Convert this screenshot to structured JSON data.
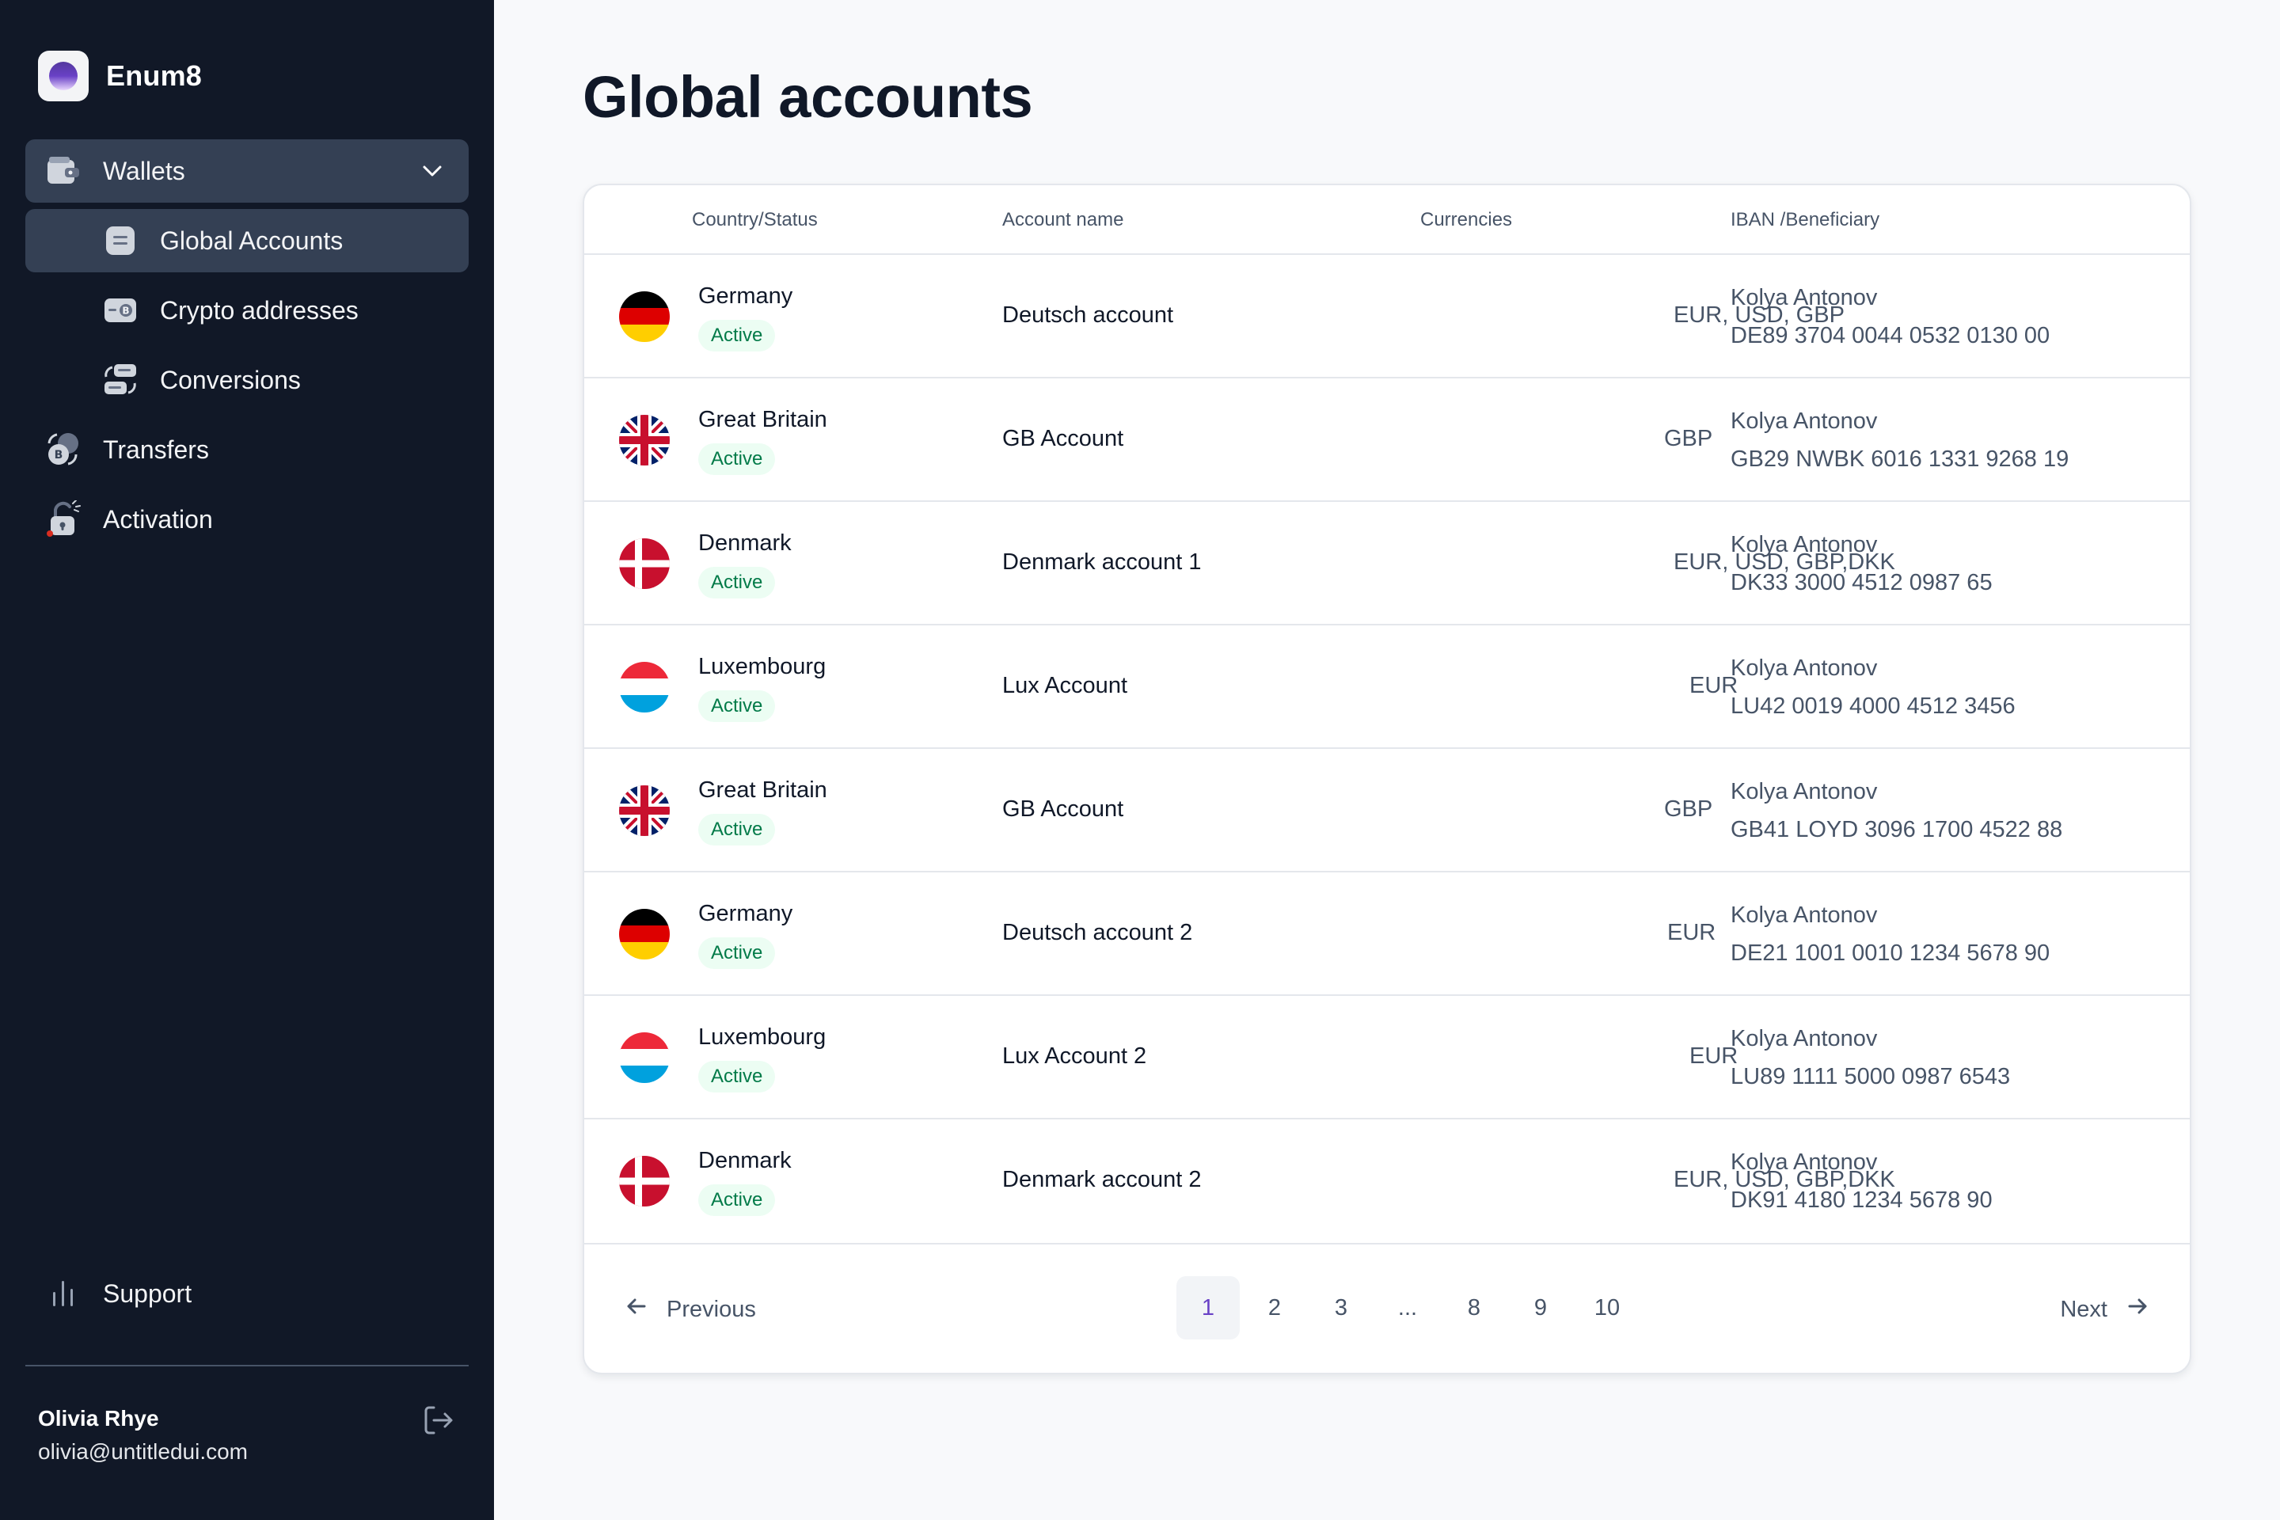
{
  "app": {
    "name": "Enum8"
  },
  "sidebar": {
    "items": [
      {
        "label": "Wallets",
        "icon": "wallet-icon"
      },
      {
        "label": "Global Accounts",
        "icon": "card-icon"
      },
      {
        "label": "Crypto addresses",
        "icon": "crypto-card-icon"
      },
      {
        "label": "Conversions",
        "icon": "conversion-icon"
      },
      {
        "label": "Transfers",
        "icon": "coins-icon"
      },
      {
        "label": "Activation",
        "icon": "lock-icon"
      }
    ],
    "support_label": "Support",
    "user": {
      "name": "Olivia Rhye",
      "email": "olivia@untitledui.com"
    }
  },
  "page": {
    "title": "Global accounts"
  },
  "table": {
    "headers": [
      "Country/Status",
      "Account name",
      "Currencies",
      "IBAN /Beneficiary"
    ],
    "rows": [
      {
        "flag": "de",
        "country": "Germany",
        "status": "Active",
        "account": "Deutsch account",
        "currencies": "EUR, USD, GBP",
        "beneficiary": "Kolya Antonov",
        "iban": "DE89 3704 0044 0532 0130 00"
      },
      {
        "flag": "gb",
        "country": "Great Britain",
        "status": "Active",
        "account": "GB Account",
        "currencies": "GBP",
        "beneficiary": "Kolya Antonov",
        "iban": "GB29 NWBK 6016 1331 9268 19"
      },
      {
        "flag": "dk",
        "country": "Denmark",
        "status": "Active",
        "account": "Denmark account 1",
        "currencies": "EUR, USD, GBP,DKK",
        "beneficiary": "Kolya Antonov",
        "iban": "DK33 3000 4512 0987 65"
      },
      {
        "flag": "lu",
        "country": "Luxembourg",
        "status": "Active",
        "account": "Lux Account",
        "currencies": "EUR",
        "beneficiary": "Kolya Antonov",
        "iban": "LU42 0019 4000 4512 3456"
      },
      {
        "flag": "gb",
        "country": "Great Britain",
        "status": "Active",
        "account": "GB Account",
        "currencies": "GBP",
        "beneficiary": "Kolya Antonov",
        "iban": "GB41 LOYD 3096 1700 4522 88"
      },
      {
        "flag": "de",
        "country": "Germany",
        "status": "Active",
        "account": "Deutsch account 2",
        "currencies": "EUR",
        "beneficiary": "Kolya Antonov",
        "iban": "DE21 1001 0010 1234 5678 90"
      },
      {
        "flag": "lu",
        "country": "Luxembourg",
        "status": "Active",
        "account": "Lux Account 2",
        "currencies": "EUR",
        "beneficiary": "Kolya Antonov",
        "iban": "LU89 1111 5000 0987 6543"
      },
      {
        "flag": "dk",
        "country": "Denmark",
        "status": "Active",
        "account": "Denmark account 2",
        "currencies": "EUR, USD, GBP,DKK",
        "beneficiary": "Kolya Antonov",
        "iban": "DK91 4180 1234 5678 90"
      }
    ]
  },
  "pagination": {
    "previous_label": "Previous",
    "next_label": "Next",
    "pages": [
      "1",
      "2",
      "3",
      "...",
      "8",
      "9",
      "10"
    ],
    "current": "1"
  },
  "colors": {
    "sidebar_bg": "#111827",
    "active_nav_bg": "#344054",
    "badge_bg": "#ecfdf3",
    "badge_text": "#027a48",
    "accent": "#6941c6"
  }
}
